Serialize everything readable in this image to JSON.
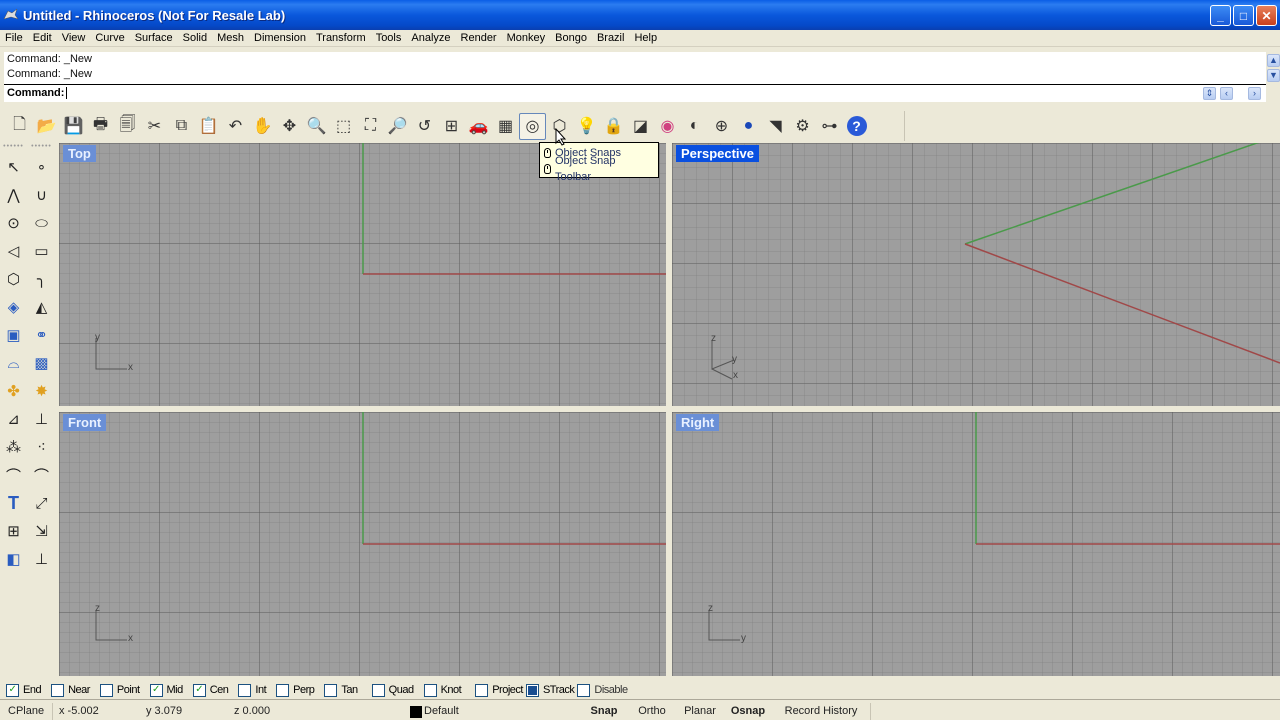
{
  "window": {
    "title": "Untitled - Rhinoceros (Not For Resale Lab)",
    "minimize": "_",
    "maximize": "□",
    "close": "✕"
  },
  "menu": [
    "File",
    "Edit",
    "View",
    "Curve",
    "Surface",
    "Solid",
    "Mesh",
    "Dimension",
    "Transform",
    "Tools",
    "Analyze",
    "Render",
    "Monkey",
    "Bongo",
    "Brazil",
    "Help"
  ],
  "command": {
    "history": [
      "Command: _New",
      "Command: _New"
    ],
    "prompt": "Command:",
    "value": ""
  },
  "toolbar": {
    "buttons": [
      {
        "name": "new-icon",
        "glyph": "🗋"
      },
      {
        "name": "open-folder-icon",
        "glyph": "📂"
      },
      {
        "name": "save-icon",
        "glyph": "💾"
      },
      {
        "name": "print-icon",
        "glyph": "🖶"
      },
      {
        "name": "import-icon",
        "glyph": "🗐"
      },
      {
        "name": "cut-icon",
        "glyph": "✂"
      },
      {
        "name": "copy-icon",
        "glyph": "⧉"
      },
      {
        "name": "paste-icon",
        "glyph": "📋"
      },
      {
        "name": "undo-icon",
        "glyph": "↶"
      },
      {
        "name": "pan-hand-icon",
        "glyph": "✋"
      },
      {
        "name": "rotate-view-icon",
        "glyph": "✥"
      },
      {
        "name": "zoom-dynamic-icon",
        "glyph": "🔍"
      },
      {
        "name": "zoom-window-icon",
        "glyph": "⬚"
      },
      {
        "name": "zoom-extents-icon",
        "glyph": "⛶"
      },
      {
        "name": "zoom-selected-icon",
        "glyph": "🔎"
      },
      {
        "name": "undo-view-icon",
        "glyph": "↺"
      },
      {
        "name": "four-viewports-icon",
        "glyph": "⊞"
      },
      {
        "name": "car-icon",
        "glyph": "🚗"
      },
      {
        "name": "grid-snap-icon",
        "glyph": "▦"
      },
      {
        "name": "object-snap-icon",
        "glyph": "◎"
      },
      {
        "name": "select-objects-icon",
        "glyph": "⬡"
      },
      {
        "name": "lightbulb-icon",
        "glyph": "💡"
      },
      {
        "name": "lock-icon",
        "glyph": "🔒"
      },
      {
        "name": "layer-icon",
        "glyph": "◪"
      },
      {
        "name": "color-wheel-icon",
        "glyph": "◉"
      },
      {
        "name": "wireframe-sphere-icon",
        "glyph": "◐"
      },
      {
        "name": "ghosted-sphere-icon",
        "glyph": "⊕"
      },
      {
        "name": "rendered-sphere-icon",
        "glyph": "●"
      },
      {
        "name": "flag-icon",
        "glyph": "◥"
      },
      {
        "name": "options-gear-icon",
        "glyph": "⚙"
      },
      {
        "name": "history-icon",
        "glyph": "⊶"
      },
      {
        "name": "help-icon",
        "glyph": "?"
      }
    ],
    "active_index": 19
  },
  "tooltip": {
    "items": [
      "Object Snaps",
      "Object Snap Toolbar"
    ]
  },
  "left_toolbar": {
    "col1": [
      {
        "name": "select-arrow-icon",
        "glyph": "↖"
      },
      {
        "name": "polyline-icon",
        "glyph": "⋀"
      },
      {
        "name": "circle-icon",
        "glyph": "⊙"
      },
      {
        "name": "arc-icon",
        "glyph": "◁"
      },
      {
        "name": "polygon-icon",
        "glyph": "⬡"
      },
      {
        "name": "surface-corner-icon",
        "glyph": "◈"
      },
      {
        "name": "box-icon",
        "glyph": "▣"
      },
      {
        "name": "cylinder-icon",
        "glyph": "⌓"
      },
      {
        "name": "boolean-icon",
        "glyph": "✤"
      },
      {
        "name": "split-icon",
        "glyph": "⊿"
      },
      {
        "name": "point-cloud-icon",
        "glyph": "⁂"
      },
      {
        "name": "curve-edit-icon",
        "glyph": "⌒"
      },
      {
        "name": "text-icon",
        "glyph": "T"
      },
      {
        "name": "array-icon",
        "glyph": "⊞"
      },
      {
        "name": "block-icon",
        "glyph": "◧"
      }
    ],
    "col2": [
      {
        "name": "point-icon",
        "glyph": "∘"
      },
      {
        "name": "curve-icon",
        "glyph": "∪"
      },
      {
        "name": "ellipse-icon",
        "glyph": "⬭"
      },
      {
        "name": "rectangle-icon",
        "glyph": "▭"
      },
      {
        "name": "fillet-icon",
        "glyph": "╮"
      },
      {
        "name": "surface-icon",
        "glyph": "◭"
      },
      {
        "name": "spheres-icon",
        "glyph": "⚭"
      },
      {
        "name": "mesh-icon",
        "glyph": "▩"
      },
      {
        "name": "explode-icon",
        "glyph": "✸"
      },
      {
        "name": "trim-icon",
        "glyph": "⊥"
      },
      {
        "name": "union-icon",
        "glyph": "⁖"
      },
      {
        "name": "offset-icon",
        "glyph": "⌒"
      },
      {
        "name": "move-icon",
        "glyph": "⤢"
      },
      {
        "name": "orient-icon",
        "glyph": "⇲"
      },
      {
        "name": "dimension-icon",
        "glyph": "⊥"
      }
    ]
  },
  "viewports": {
    "top": {
      "label": "Top",
      "axes": [
        "y",
        "x"
      ]
    },
    "perspective": {
      "label": "Perspective",
      "axes": [
        "z",
        "y",
        "x"
      ]
    },
    "front": {
      "label": "Front",
      "axes": [
        "z",
        "x"
      ]
    },
    "right": {
      "label": "Right",
      "axes": [
        "z",
        "y"
      ]
    }
  },
  "osnaps": [
    {
      "label": "End",
      "checked": true
    },
    {
      "label": "Near",
      "checked": false
    },
    {
      "label": "Point",
      "checked": false
    },
    {
      "label": "Mid",
      "checked": true
    },
    {
      "label": "Cen",
      "checked": true
    },
    {
      "label": "Int",
      "checked": false
    },
    {
      "label": "Perp",
      "checked": false
    },
    {
      "label": "Tan",
      "checked": false
    },
    {
      "label": "Quad",
      "checked": false
    },
    {
      "label": "Knot",
      "checked": false
    },
    {
      "label": "Project",
      "checked": false
    },
    {
      "label": "STrack",
      "checked": true
    },
    {
      "label": "Disable",
      "checked": false
    }
  ],
  "statusbar": {
    "cplane": "CPlane",
    "x": "x -5.002",
    "y": "y 3.079",
    "z": "z 0.000",
    "layer": "Default",
    "layer_color": "#000000",
    "snap": "Snap",
    "ortho": "Ortho",
    "planar": "Planar",
    "osnap": "Osnap",
    "record_history": "Record History"
  },
  "colors": {
    "x_axis": "#a04848",
    "y_axis": "#4a9a4a",
    "active_viewport_label": "#0a50e0",
    "viewport_label": "#6a8fd6"
  }
}
